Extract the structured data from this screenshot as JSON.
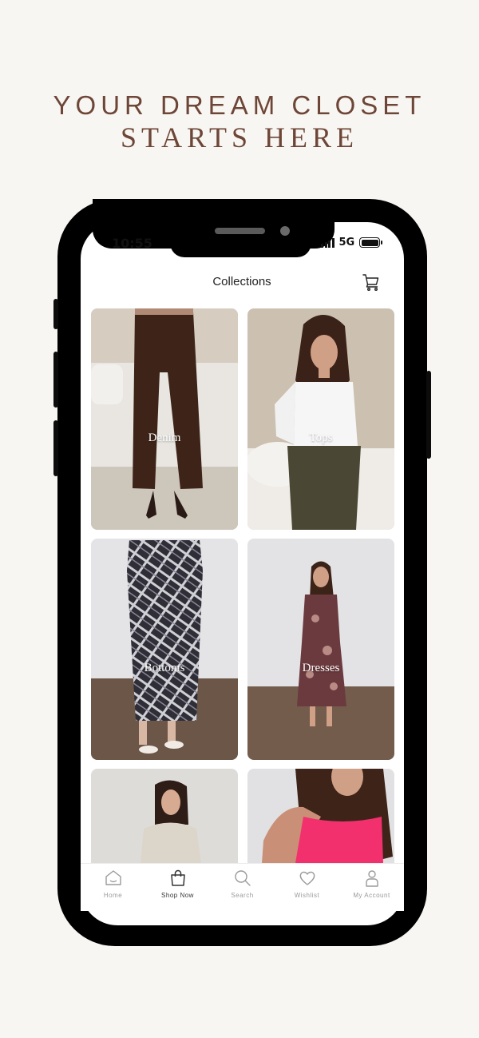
{
  "headline": {
    "line1": "YOUR DREAM CLOSET",
    "line2": "STARTS HERE"
  },
  "status_bar": {
    "time": "10:55",
    "network": "5G"
  },
  "header": {
    "title": "Collections",
    "cart_icon": "cart-icon"
  },
  "collections": [
    {
      "label": "Denim",
      "image": "model-in-brown-jeans"
    },
    {
      "label": "Tops",
      "image": "model-in-white-top"
    },
    {
      "label": "Bottoms",
      "image": "model-in-plaid-skirt"
    },
    {
      "label": "Dresses",
      "image": "model-in-floral-dress"
    },
    {
      "label": "",
      "image": "model-in-cream-sweater"
    },
    {
      "label": "",
      "image": "model-in-pink-top"
    }
  ],
  "bottom_nav": [
    {
      "label": "Home",
      "icon": "home-icon"
    },
    {
      "label": "Shop Now",
      "icon": "shopping-bag-icon",
      "active": true
    },
    {
      "label": "Search",
      "icon": "search-icon"
    },
    {
      "label": "Wishlist",
      "icon": "heart-icon"
    },
    {
      "label": "My Account",
      "icon": "user-icon"
    }
  ],
  "colors": {
    "background": "#f8f6f2",
    "headline": "#6e4638",
    "phone_frame": "#000000"
  }
}
